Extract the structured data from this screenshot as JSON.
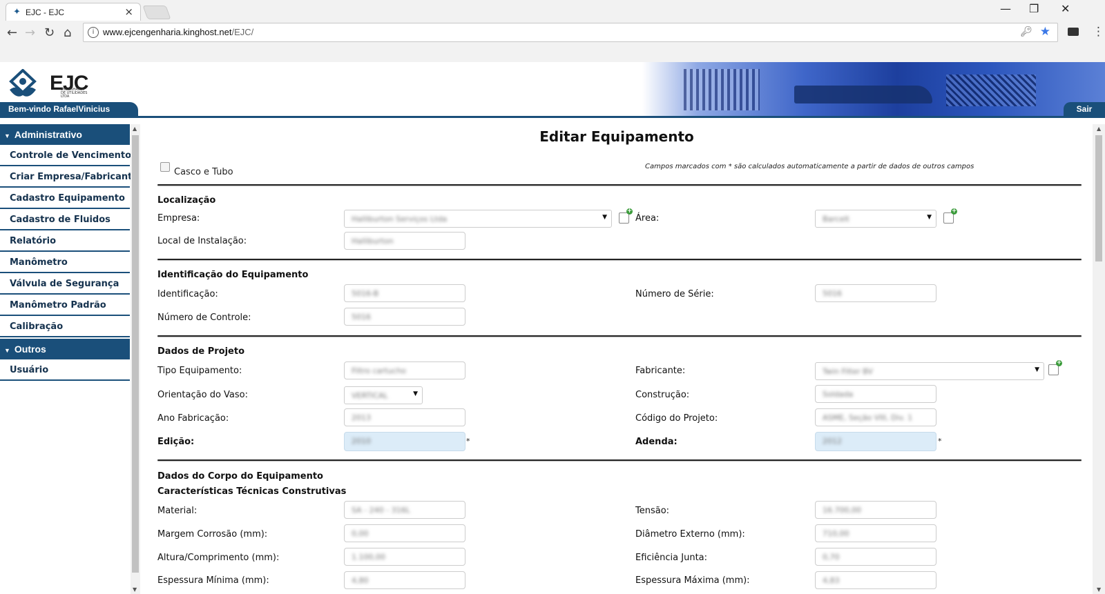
{
  "browser": {
    "tab_title": "EJC - EJC",
    "tab_close": "×",
    "url_host": "www.ejcengenharia.kinghost.net",
    "url_path": "/EJC/",
    "win_min": "—",
    "win_restore": "❐",
    "win_close": "✕"
  },
  "site": {
    "logo_text": "EJC",
    "logo_sub": "ENGENHARIA DE UTILIDADES LTDA",
    "welcome": "Bem-vindo RafaelVinicius",
    "logout": "Sair"
  },
  "sidebar": {
    "group_admin": "Administrativo",
    "items_admin": [
      "Controle de Vencimentos",
      "Criar Empresa/Fabricante",
      "Cadastro Equipamento",
      "Cadastro de Fluidos",
      "Relatório",
      "Manômetro",
      "Válvula de Segurança",
      "Manômetro Padrão",
      "Calibração"
    ],
    "group_other": "Outros",
    "items_other": [
      "Usuário"
    ]
  },
  "form": {
    "title": "Editar Equipamento",
    "checkbox_label": "Casco e Tubo",
    "checkbox_checked": false,
    "note": "Campos marcados com * são calculados automaticamente a partir de dados de outros campos",
    "sec_localizacao": "Localização",
    "lbl_empresa": "Empresa:",
    "val_empresa": "Halliburton Serviços Ltda",
    "lbl_area": "Área:",
    "val_area": "Barcelt",
    "lbl_local": "Local de Instalação:",
    "val_local": "Halliburton",
    "sec_identificacao": "Identificação do Equipamento",
    "lbl_identificacao": "Identificação:",
    "val_identificacao": "5016-B",
    "lbl_serie": "Número de Série:",
    "val_serie": "5016",
    "lbl_controle": "Número de Controle:",
    "val_controle": "5016",
    "sec_projeto": "Dados de Projeto",
    "lbl_tipo": "Tipo Equipamento:",
    "val_tipo": "Filtro cartucho",
    "lbl_fabricante": "Fabricante:",
    "val_fabricante": "Twin Filter BV",
    "lbl_orientacao": "Orientação do Vaso:",
    "val_orientacao": "VERTICAL",
    "lbl_construcao": "Construção:",
    "val_construcao": "Soldada",
    "lbl_ano": "Ano Fabricação:",
    "val_ano": "2013",
    "lbl_codigo": "Código do Projeto:",
    "val_codigo": "ASME, Seção VIII, Div. 1",
    "lbl_edicao": "Edição:",
    "val_edicao": "2010",
    "lbl_adenda": "Adenda:",
    "val_adenda": "2012",
    "asterisk": "*",
    "sec_corpo": "Dados do Corpo do Equipamento",
    "sec_caracteristicas": "Características Técnicas Construtivas",
    "lbl_material": "Material:",
    "val_material": "SA - 240 - 316L",
    "lbl_tensao": "Tensão:",
    "val_tensao": "16.700,00",
    "lbl_margem": "Margem Corrosão (mm):",
    "val_margem": "0,00",
    "lbl_diametro": "Diâmetro Externo (mm):",
    "val_diametro": "710,00",
    "lbl_altura": "Altura/Comprimento (mm):",
    "val_altura": "1.100,00",
    "lbl_eficiencia": "Eficiência Junta:",
    "val_eficiencia": "0,70",
    "lbl_esp_min": "Espessura Mínima (mm):",
    "val_esp_min": "4,80",
    "lbl_esp_max": "Espessura Máxima (mm):",
    "val_esp_max": "4,83"
  },
  "colors": {
    "brand_blue": "#1a4f7a",
    "readonly_bg": "#dcecf8"
  },
  "icons": {
    "back": "arrow-left-icon",
    "forward": "arrow-right-icon",
    "reload": "reload-icon",
    "home": "home-icon",
    "info": "info-icon",
    "star": "bookmark-star-icon",
    "add": "add-item-icon"
  }
}
